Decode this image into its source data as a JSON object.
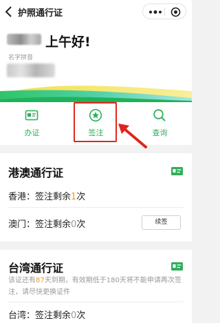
{
  "header": {
    "title": "护照通行证",
    "greeting": "上午好!",
    "pinyin_label": "名字拼音"
  },
  "menu": {
    "items": [
      {
        "label": "办证",
        "icon": "id-card-icon"
      },
      {
        "label": "签注",
        "icon": "star-circle-icon"
      },
      {
        "label": "查询",
        "icon": "search-icon"
      }
    ]
  },
  "hk_macau": {
    "title": "港澳通行证",
    "hk_prefix": "香港：签注剩余",
    "hk_count": "1",
    "hk_suffix": "次",
    "macau_prefix": "澳门：签注剩余",
    "macau_count": "0",
    "macau_suffix": "次",
    "renew_label": "续签"
  },
  "taiwan": {
    "title": "台湾通行证",
    "notice_prefix": "该证还有",
    "notice_days": "87",
    "notice_suffix": "天到期，有效期低于180天将不能申请再次签注，请尽快更换证件",
    "tw_prefix": "台湾：签注剩余",
    "tw_count": "0",
    "tw_suffix": "次"
  },
  "colors": {
    "accent_green": "#2fae5a",
    "highlight_red": "#e0241b",
    "count_orange": "#f39c12"
  }
}
